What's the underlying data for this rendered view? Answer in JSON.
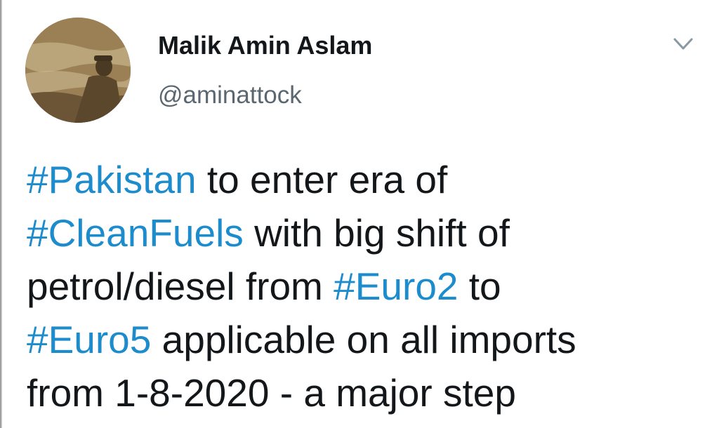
{
  "user": {
    "display_name": "Malik Amin Aslam",
    "handle": "@aminattock"
  },
  "tweet": {
    "lines": [
      [
        {
          "hashtag": "#Pakistan"
        },
        {
          "text": " to enter era of"
        }
      ],
      [
        {
          "hashtag": "#CleanFuels"
        },
        {
          "text": " with big shift of"
        }
      ],
      [
        {
          "text": "petrol/diesel from "
        },
        {
          "hashtag": "#Euro2"
        },
        {
          "text": " to"
        }
      ],
      [
        {
          "hashtag": "#Euro5"
        },
        {
          "text": " applicable on all imports"
        }
      ],
      [
        {
          "text": "from 1-8-2020 - a major step"
        }
      ]
    ]
  },
  "icons": {
    "caret": "chevron-down-icon",
    "avatar": "profile-photo"
  },
  "colors": {
    "hashtag": "#1d8ccd",
    "text": "#14171a",
    "handle": "#5b6770",
    "caret": "#8899a6"
  }
}
